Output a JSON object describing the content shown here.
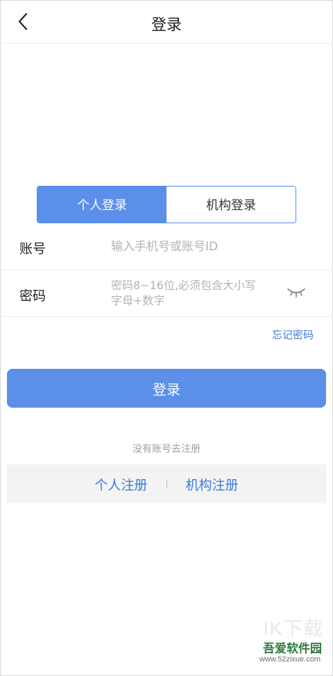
{
  "header": {
    "title": "登录",
    "back_icon": "chevron-left-icon"
  },
  "tabs": [
    {
      "label": "个人登录",
      "active": true
    },
    {
      "label": "机构登录",
      "active": false
    }
  ],
  "form": {
    "account": {
      "label": "账号",
      "placeholder": "输入手机号或账号ID",
      "value": ""
    },
    "password": {
      "label": "密码",
      "placeholder": "密码8~16位,必须包含大小写\n字母+数字",
      "value": "",
      "toggle_icon": "eye-closed-icon"
    }
  },
  "forgot_password": "忘记密码",
  "login_button": "登录",
  "register": {
    "prompt": "没有账号去注册",
    "personal": "个人注册",
    "institution": "机构注册"
  },
  "watermark": {
    "letters": "IK下载",
    "name": "吾爱软件园",
    "url": "www.52zixue.com"
  },
  "colors": {
    "accent": "#5b8fe9",
    "link": "#3f7ad9",
    "placeholder": "#b3b3b3",
    "register_bar": "#f3f3f3"
  }
}
